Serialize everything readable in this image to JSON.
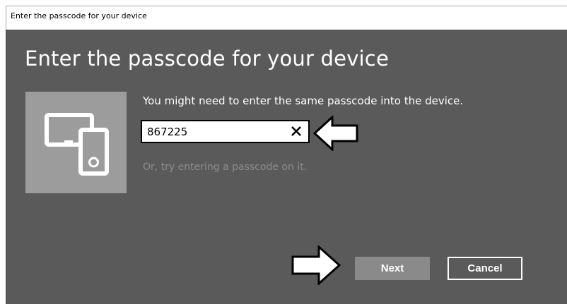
{
  "window": {
    "title": "Enter the passcode for your device"
  },
  "dialog": {
    "heading": "Enter the passcode for your device",
    "message": "You might need to enter the same passcode into the device.",
    "passcode_value": "867225",
    "hint": "Or, try entering a passcode on it.",
    "next_label": "Next",
    "cancel_label": "Cancel"
  },
  "colors": {
    "dialog_background": "#5a5a5a",
    "tile_background": "#9c9c9c",
    "next_button": "#8a8a8a",
    "hint_text": "#8d8d8d"
  },
  "icons": {
    "device": "devices-icon",
    "clear": "close-icon",
    "annotation": "arrow-annotation-icon"
  }
}
